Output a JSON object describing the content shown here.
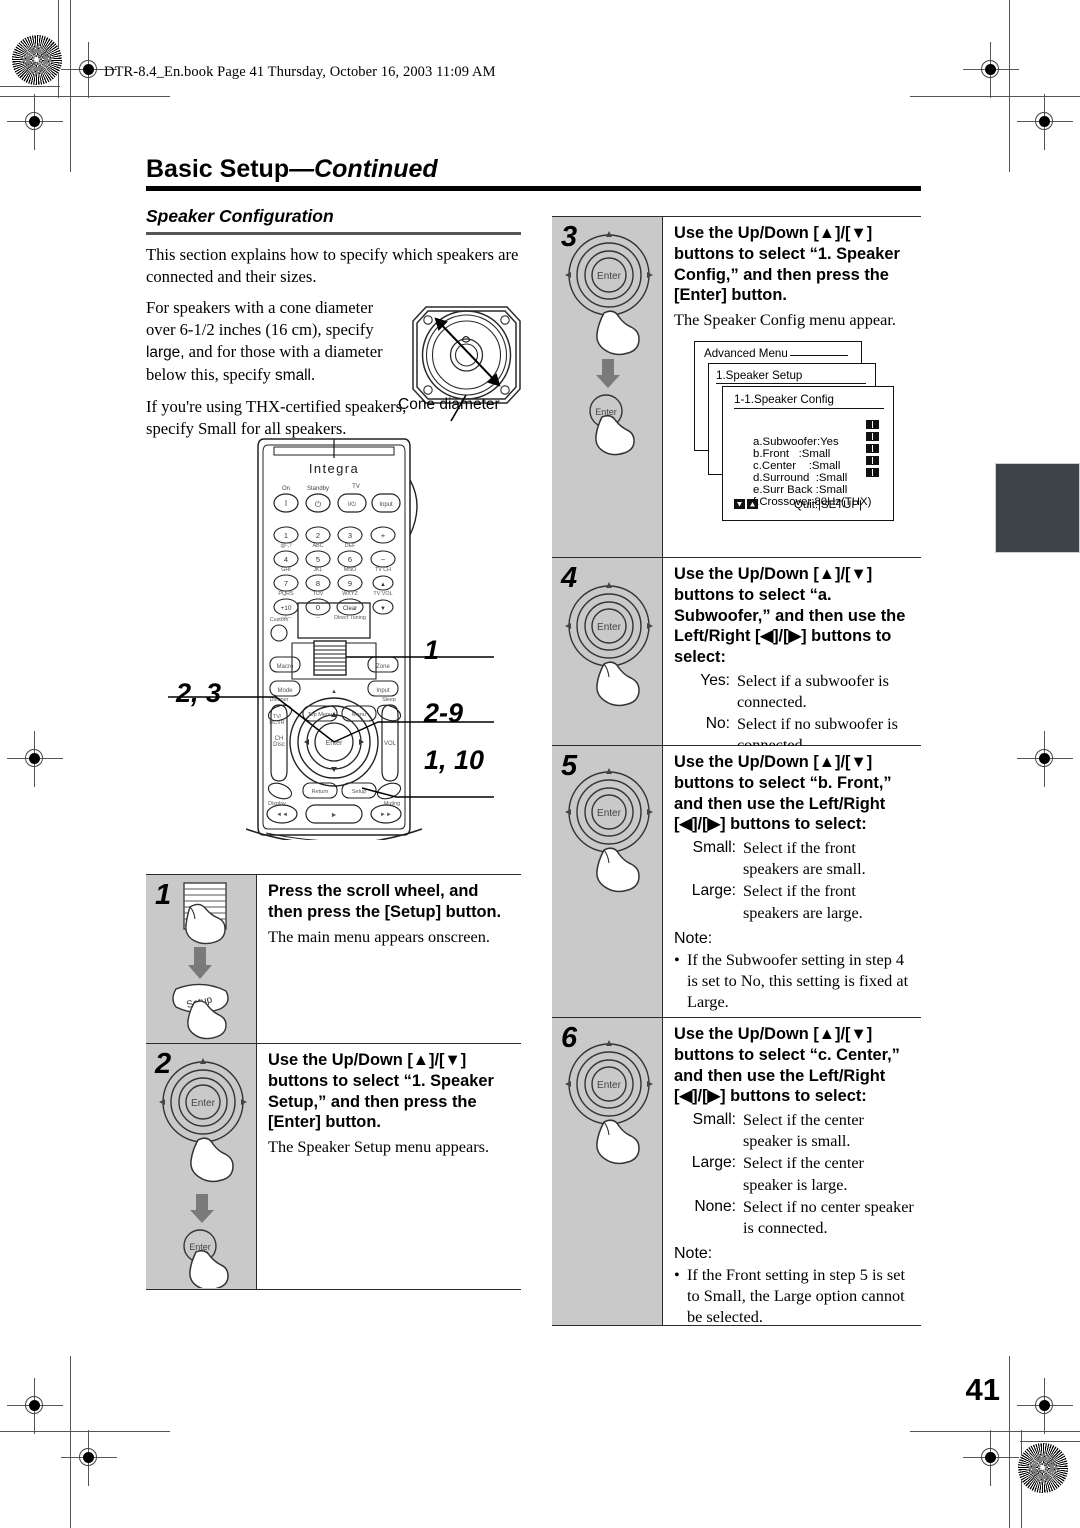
{
  "header": {
    "file_line": "DTR-8.4_En.book  Page 41  Thursday, October 16, 2003  11:09 AM"
  },
  "page_title": {
    "main": "Basic Setup",
    "continued": "—Continued"
  },
  "page_number": "41",
  "section": {
    "heading": "Speaker Configuration",
    "paragraphs": [
      "This section explains how to specify which speakers are connected and their sizes.",
      "For speakers with a cone diameter over 6-1/2 inches (16 cm), specify large, and for those with a diameter below this, specify small.",
      "If you're using THX-certified speakers, specify Small for all speakers."
    ],
    "para2_parts": {
      "a": "For speakers with a cone diameter over 6-1/2 inches (16 cm), specify ",
      "large": "large,",
      "b": " and for those with a diameter below this, specify ",
      "small": "small",
      "c": "."
    }
  },
  "cone_figure": {
    "label": "Cone diameter"
  },
  "remote": {
    "brand": "Integra",
    "callouts": [
      {
        "id": "callout-1",
        "text": "1"
      },
      {
        "id": "callout-2-3",
        "text": "2, 3"
      },
      {
        "id": "callout-2-9",
        "text": "2-9"
      },
      {
        "id": "callout-1-10",
        "text": "1, 10"
      }
    ],
    "buttons": {
      "on": "On",
      "standby": "Standby",
      "tv": "TV",
      "tv_on_off": "I/⏻",
      "tv_input": "Input",
      "row1": [
        "1",
        "2",
        "3"
      ],
      "row1_sub": [
        "@-,'/",
        "ABC",
        "DEF"
      ],
      "row2": [
        "4",
        "5",
        "6"
      ],
      "row2_sub": [
        "GHI",
        "JKL",
        "MNO"
      ],
      "row3": [
        "7",
        "8",
        "9"
      ],
      "row3_sub": [
        "PQRS",
        "TUV",
        "WXYZ"
      ],
      "row4": [
        "+10",
        "0",
        "Clear"
      ],
      "row4_sub": [
        "--/---",
        "--",
        "Direct Tuning"
      ],
      "tvch": "TV CH",
      "tvvol": "TV VOL",
      "custom": "Custom",
      "macro": "Macro",
      "mode": "Mode",
      "zone": "Zone",
      "input": "Input",
      "dimmer": "Dimmer",
      "sleep": "Sleep",
      "tv_rcvr": "TV/ RCVR",
      "top_menu": "Top Menu",
      "menu": "Menu",
      "enter": "Enter",
      "ch_disc": "CH Disc",
      "vol": "VOL",
      "return": "Return",
      "setup": "Setup",
      "display": "Display",
      "muting": "Muting"
    }
  },
  "steps": [
    {
      "num": "1",
      "icon": "scroll-wheel-then-setup",
      "lead": "Press the scroll wheel, and then press the [Setup] button.",
      "note": "The main menu appears onscreen.",
      "options": [],
      "notes_head": "",
      "notes_bullets": []
    },
    {
      "num": "2",
      "icon": "enter-wheel",
      "lead": "Use the Up/Down [▲]/[▼] buttons to select “1. Speaker Setup,” and then press the [Enter] button.",
      "note": "The Speaker Setup menu appears.",
      "options": [],
      "notes_head": "",
      "notes_bullets": []
    },
    {
      "num": "3",
      "icon": "enter-wheel",
      "lead": "Use the Up/Down [▲]/[▼] buttons to select “1. Speaker Config,” and then press the [Enter] button.",
      "note": "The Speaker Config menu appear.",
      "options": [],
      "notes_head": "",
      "notes_bullets": []
    },
    {
      "num": "4",
      "icon": "enter-wheel",
      "lead": "Use the Up/Down [▲]/[▼] buttons to select “a. Subwoofer,” and then use the Left/Right [◀]/[▶] buttons to select:",
      "note": "",
      "options": [
        {
          "key": "Yes:",
          "value": "Select if a subwoofer is connected."
        },
        {
          "key": "No:",
          "value": "Select if no subwoofer is connected."
        }
      ],
      "notes_head": "",
      "notes_bullets": []
    },
    {
      "num": "5",
      "icon": "enter-wheel",
      "lead": "Use the Up/Down [▲]/[▼] buttons to select “b. Front,” and then use the Left/Right [◀]/[▶] buttons to select:",
      "note": "",
      "options": [
        {
          "key": "Small:",
          "value": "Select if the front speakers are small."
        },
        {
          "key": "Large:",
          "value": "Select if the front speakers are large."
        }
      ],
      "notes_head": "Note:",
      "notes_bullets": [
        "If the Subwoofer setting in step 4 is set to No, this setting is fixed at Large."
      ]
    },
    {
      "num": "6",
      "icon": "enter-wheel",
      "lead": "Use the Up/Down [▲]/[▼] buttons to select “c. Center,” and then use the Left/Right [◀]/[▶] buttons to select:",
      "note": "",
      "options": [
        {
          "key": "Small:",
          "value": "Select if the center speaker is small."
        },
        {
          "key": "Large:",
          "value": "Select if the center speaker is large."
        },
        {
          "key": "None:",
          "value": "Select if no center speaker is connected."
        }
      ],
      "notes_head": "Note:",
      "notes_bullets": [
        "If the Front setting in step 5 is set to Small, the Large option cannot be selected."
      ]
    }
  ],
  "osd": {
    "window1_title": "Advanced Menu",
    "window2_title": "1.Speaker Setup",
    "window3_title": "1-1.Speaker Config",
    "rows": [
      {
        "label": "a.Subwoofer",
        "value": ":Yes",
        "has_lr": true
      },
      {
        "label": "b.Front",
        "value": "   :Small",
        "has_lr": true
      },
      {
        "label": "c.Center",
        "value": "    :Small",
        "has_lr": true
      },
      {
        "label": "d.Surround",
        "value": "  :Small",
        "has_lr": true
      },
      {
        "label": "e.Surr Back",
        "value": " :Small",
        "has_lr": true
      },
      {
        "label": "f.Crossover",
        "value": ":80Hz(THX)",
        "has_lr": false
      }
    ],
    "footer_quit": "Quit:|SETUP|"
  },
  "colors": {
    "step_icon_bg": "#c9c9c9",
    "rule": "#000000",
    "thumb_tab": "#3c4448"
  }
}
